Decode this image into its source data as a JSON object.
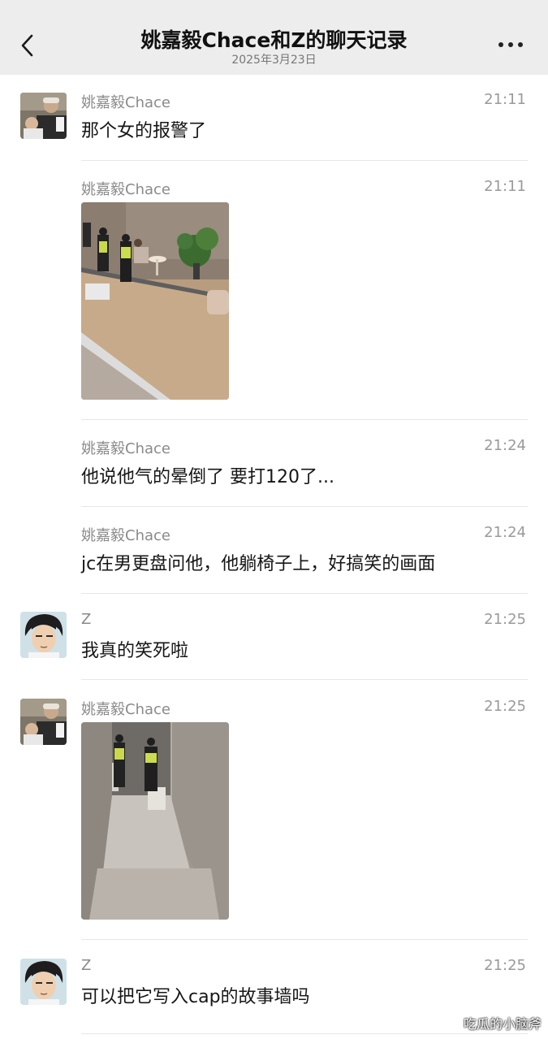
{
  "header": {
    "title": "姚嘉毅Chace和Z的聊天记录",
    "date": "2025年3月23日",
    "back_icon": "chevron-left-icon",
    "more_icon": "more-icon"
  },
  "messages": [
    {
      "sender": "姚嘉毅Chace",
      "time": "21:11",
      "text": "那个女的报警了"
    },
    {
      "sender": "姚嘉毅Chace",
      "time": "21:11",
      "type": "image",
      "image": "photo of police officers in a lobby"
    },
    {
      "sender": "姚嘉毅Chace",
      "time": "21:24",
      "text": "他说他气的晕倒了 要打120了..."
    },
    {
      "sender": "姚嘉毅Chace",
      "time": "21:24",
      "text": "jc在男更盘问他，他躺椅子上，好搞笑的画面"
    },
    {
      "sender": "Z",
      "time": "21:25",
      "text": "我真的笑死啦"
    },
    {
      "sender": "姚嘉毅Chace",
      "time": "21:25",
      "type": "image",
      "image": "photo of police officers in a corridor"
    },
    {
      "sender": "Z",
      "time": "21:25",
      "text": "可以把它写入cap的故事墙吗"
    }
  ],
  "watermark": "吃瓜的小脑斧",
  "colors": {
    "header_bg": "#ededed",
    "page_bg": "#ffffff",
    "meta_text": "#8a8a8a",
    "divider": "#e6e6e6"
  }
}
